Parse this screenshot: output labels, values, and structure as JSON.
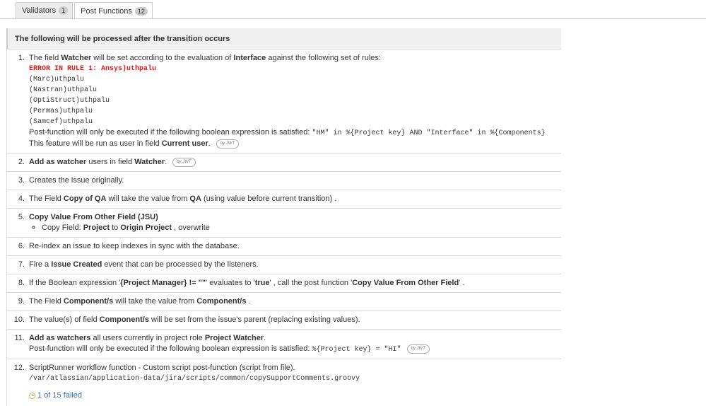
{
  "tabs": {
    "validators": {
      "label": "Validators",
      "count": "1"
    },
    "post_functions": {
      "label": "Post Functions",
      "count": "12"
    }
  },
  "panel": {
    "title": "The following will be processed after the transition occurs"
  },
  "jwt_badge": "by JWT",
  "items": {
    "i1": {
      "num": "1.",
      "pre": "The field ",
      "field": "Watcher",
      "mid": " will be set according to the evaluation of ",
      "src": "Interface",
      "post": " against the following set of rules:",
      "error": "ERROR IN RULE 1: Ansys)uthpalu",
      "rules": [
        "(Marc)uthpalu",
        "(Nastran)uthpalu",
        "(OptiStruct)uthpalu",
        "(Permas)uthpalu",
        "(Samcef)uthpalu"
      ],
      "cond_text": "Post-function will only be executed if the following boolean expression is satisfied: ",
      "cond_expr": "\"HM\" in %{Project key} AND \"Interface\" in %{Components}",
      "runas_text": "This feature will be run as user in field ",
      "runas_field": "Current user",
      "runas_end": "."
    },
    "i2": {
      "num": "2.",
      "b1": "Add as watcher",
      "t1": " users in field ",
      "b2": "Watcher",
      "t2": "."
    },
    "i3": {
      "num": "3.",
      "text": "Creates the issue originally."
    },
    "i4": {
      "num": "4.",
      "t1": "The Field ",
      "b1": "Copy of QA",
      "t2": " will take the value from ",
      "b2": "QA",
      "t3": " (using value before current transition) ."
    },
    "i5": {
      "num": "5.",
      "b1": "Copy Value From Other Field (JSU)",
      "s1": "Copy Field: ",
      "sb1": "Project",
      "s2": " to ",
      "sb2": "Origin Project",
      "s3": " , overwrite"
    },
    "i6": {
      "num": "6.",
      "text": "Re-index an issue to keep indexes in sync with the database."
    },
    "i7": {
      "num": "7.",
      "t1": "Fire a ",
      "b1": "Issue Created",
      "t2": " event that can be processed by the listeners."
    },
    "i8": {
      "num": "8.",
      "t1": "If the Boolean expression '",
      "b1": "{Project Manager} != \"\"",
      "t2": "' evaluates to '",
      "b2": "true",
      "t3": "' , call the post function '",
      "b3": "Copy Value From Other Field",
      "t4": "' ."
    },
    "i9": {
      "num": "9.",
      "t1": "The Field ",
      "b1": "Component/s",
      "t2": " will take the value from ",
      "b2": "Component/s",
      "t3": " ."
    },
    "i10": {
      "num": "10.",
      "t1": "The value(s) of field ",
      "b1": "Component/s",
      "t2": " will be set from the issue's parent (replacing existing values)."
    },
    "i11": {
      "num": "11.",
      "b1": "Add as watchers",
      "t1": " all users currently in project role ",
      "b2": "Project Watcher",
      "t2": ".",
      "cond_text": "Post-function will only be executed if the following boolean expression is satisfied: ",
      "cond_expr": "%{Project key} = \"HI\""
    },
    "i12": {
      "num": "12.",
      "text": "ScriptRunner workflow function - Custom script post-function (script from file).",
      "path": "/var/atlassian/application-data/jira/scripts/common/copySupportComments.groovy",
      "failed": "1 of 15 failed"
    }
  }
}
